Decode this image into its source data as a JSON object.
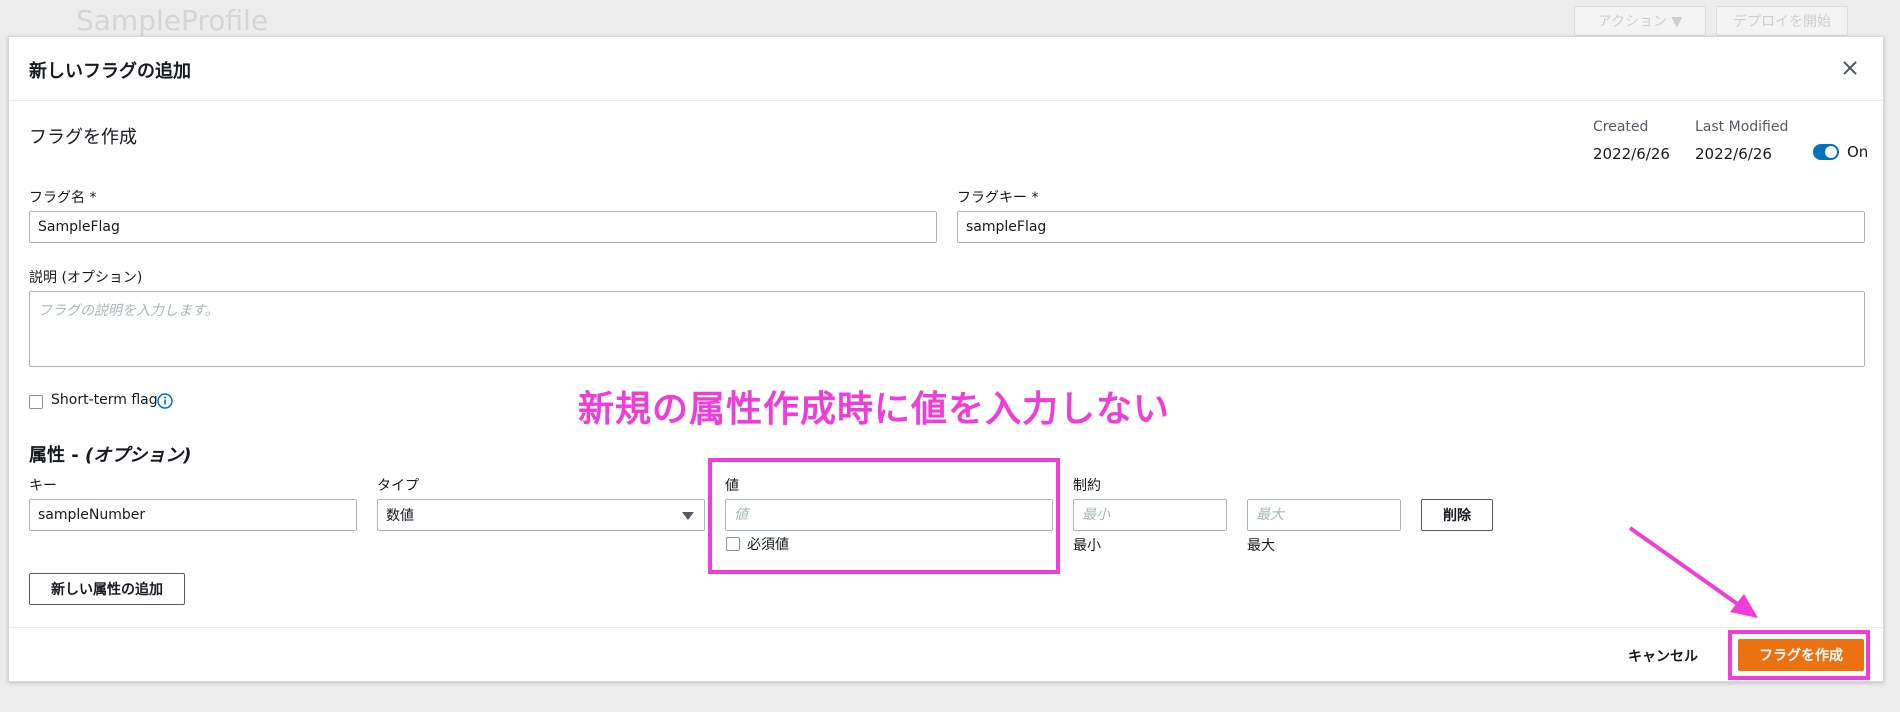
{
  "background": {
    "page_title": "SampleProfile",
    "actions_button": "アクション ▼",
    "deploy_button": "デプロイを開始"
  },
  "modal": {
    "title": "新しいフラグの追加",
    "section_title": "フラグを作成",
    "created_label": "Created",
    "created_value": "2022/6/26",
    "modified_label": "Last Modified",
    "modified_value": "2022/6/26",
    "toggle_label": "On",
    "flag_name_label": "フラグ名 *",
    "flag_name_value": "SampleFlag",
    "flag_key_label": "フラグキー *",
    "flag_key_value": "sampleFlag",
    "description_label": "説明 (オプション)",
    "description_placeholder": "フラグの説明を入力します。",
    "short_term_label": "Short-term flag",
    "attributes_title_main": "属性 - ",
    "attributes_title_opt": "(オプション)",
    "attr": {
      "key_label": "キー",
      "key_value": "sampleNumber",
      "type_label": "タイプ",
      "type_value": "数値",
      "value_label": "値",
      "value_placeholder": "値",
      "required_label": "必須値",
      "constraint_label": "制約",
      "min_placeholder": "最小",
      "max_placeholder": "最大",
      "min_caption": "最小",
      "max_caption": "最大",
      "delete_button": "削除"
    },
    "add_attribute_button": "新しい属性の追加",
    "cancel_button": "キャンセル",
    "create_button": "フラグを作成"
  },
  "annotation_text": "新規の属性作成時に値を入力しない",
  "colors": {
    "accent_pink": "#f03cd8",
    "primary_orange": "#ec7211",
    "toggle_blue": "#0073bb"
  }
}
